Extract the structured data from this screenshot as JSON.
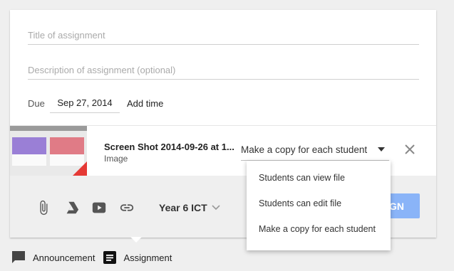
{
  "form": {
    "title_placeholder": "Title of assignment",
    "description_placeholder": "Description of assignment (optional)",
    "due_label": "Due",
    "due_date": "Sep 27, 2014",
    "add_time_label": "Add time"
  },
  "attachment": {
    "file_name": "Screen Shot 2014-09-26 at 1...",
    "file_type": "Image",
    "share_option": "Make a copy for each student",
    "thumbnail_colors": {
      "purple": "#9a7fd6",
      "pink": "#e07b86",
      "drive_corner": "#e53935"
    }
  },
  "share_menu": {
    "options": [
      "Students can view file",
      "Students can edit file",
      "Make a copy for each student"
    ]
  },
  "toolbar": {
    "icons": [
      "paperclip-icon",
      "google-drive-icon",
      "youtube-icon",
      "link-icon"
    ],
    "class_name": "Year 6 ICT",
    "assign_label": "GN",
    "accent_color": "#8ab4f8"
  },
  "bottom_nav": {
    "announcement_label": "Announcement",
    "assignment_label": "Assignment"
  }
}
